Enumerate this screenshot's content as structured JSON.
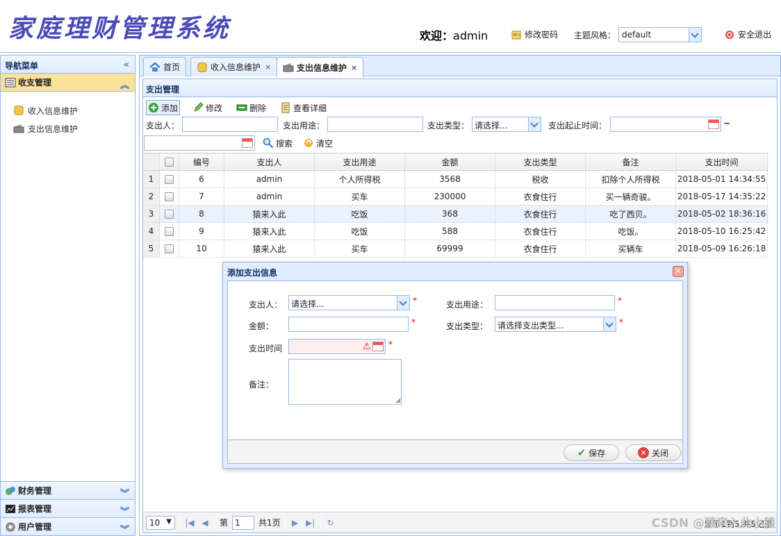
{
  "app": {
    "title": "家庭理财管理系统",
    "welcome_label": "欢迎：",
    "user": "admin",
    "change_pwd": "修改密码",
    "theme_label": "主题风格：",
    "theme_value": "default",
    "logout": "安全退出"
  },
  "nav": {
    "title": "导航菜单",
    "active_section": "收支管理",
    "items": [
      "收入信息维护",
      "支出信息维护"
    ],
    "sections": [
      "财务管理",
      "报表管理",
      "用户管理"
    ]
  },
  "tabs": [
    {
      "label": "首页"
    },
    {
      "label": "收入信息维护"
    },
    {
      "label": "支出信息维护"
    }
  ],
  "panel": {
    "title": "支出管理",
    "toolbar": [
      "添加",
      "修改",
      "删除",
      "查看详细"
    ],
    "filters": {
      "payer_label": "支出人：",
      "purpose_label": "支出用途：",
      "type_label": "支出类型：",
      "type_value": "请选择...",
      "time_label": "支出起止时间：",
      "tilde": "~",
      "search": "搜索",
      "clear": "清空"
    }
  },
  "grid": {
    "columns": [
      "编号",
      "支出人",
      "支出用途",
      "金额",
      "支出类型",
      "备注",
      "支出时间"
    ],
    "rows": [
      {
        "rn": "1",
        "id": "6",
        "payer": "admin",
        "purpose": "个人所得税",
        "amount": "3568",
        "type": "税收",
        "note": "扣除个人所得税",
        "time": "2018-05-01 14:34:55"
      },
      {
        "rn": "2",
        "id": "7",
        "payer": "admin",
        "purpose": "买车",
        "amount": "230000",
        "type": "衣食住行",
        "note": "买一辆奇骏。",
        "time": "2018-05-17 14:35:22"
      },
      {
        "rn": "3",
        "id": "8",
        "payer": "猿来入此",
        "purpose": "吃饭",
        "amount": "368",
        "type": "衣食住行",
        "note": "吃了西贝。",
        "time": "2018-05-02 18:36:16"
      },
      {
        "rn": "4",
        "id": "9",
        "payer": "猿来入此",
        "purpose": "吃饭",
        "amount": "588",
        "type": "衣食住行",
        "note": "吃饭。",
        "time": "2018-05-10 16:25:42"
      },
      {
        "rn": "5",
        "id": "10",
        "payer": "猿来入此",
        "purpose": "买车",
        "amount": "69999",
        "type": "衣食住行",
        "note": "买辆车",
        "time": "2018-05-09 16:26:18"
      }
    ]
  },
  "pager": {
    "page_size": "10",
    "page_prefix": "第",
    "page_value": "1",
    "page_suffix": "共1页",
    "info": "显示1到5,共5记录"
  },
  "dialog": {
    "title": "添加支出信息",
    "payer_label": "支出人：",
    "payer_value": "请选择...",
    "purpose_label": "支出用途：",
    "amount_label": "金额：",
    "type_label": "支出类型：",
    "type_value": "请选择支出类型...",
    "time_label": "支出时间",
    "note_label": "备注：",
    "required": "*",
    "save": "保存",
    "close": "关闭"
  },
  "watermark": "CSDN @猿来入此小猿"
}
